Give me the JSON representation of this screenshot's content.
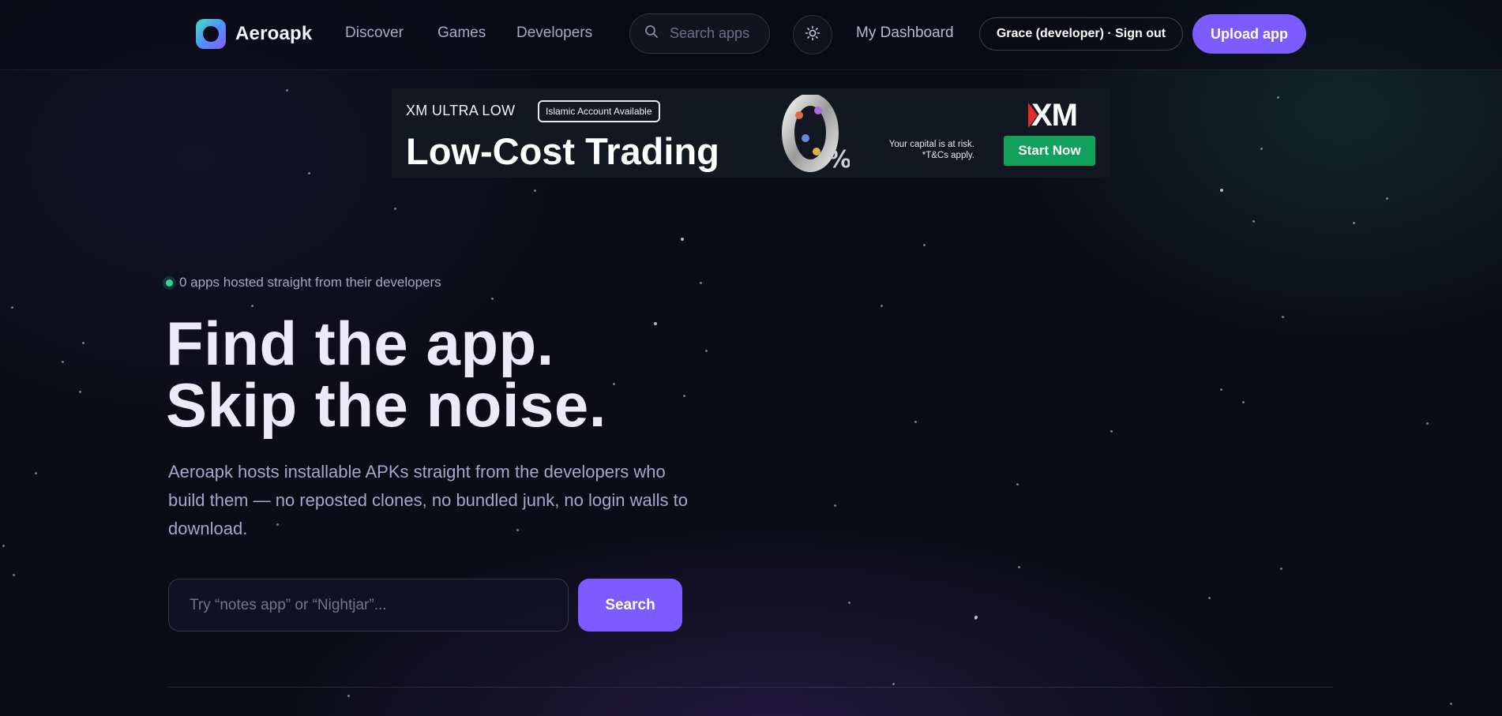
{
  "header": {
    "brand": "Aeroapk",
    "nav": [
      "Discover",
      "Games",
      "Developers"
    ],
    "search_placeholder": "Search apps",
    "dashboard_label": "My Dashboard",
    "account_label": "Grace (developer) · Sign out",
    "upload_label": "Upload app",
    "icons": {
      "search": "search-icon",
      "theme": "sun-icon"
    }
  },
  "ad": {
    "tag": "XM ULTRA LOW",
    "badge": "Islamic Account Available",
    "headline": "Low-Cost Trading",
    "risk_line1": "Your capital is at risk.",
    "risk_line2": "*T&Cs apply.",
    "brand": "XM",
    "cta": "Start Now",
    "colors": {
      "brand_red": "#e22b2b",
      "cta_green": "#12a15a"
    }
  },
  "hero": {
    "status": "0 apps hosted straight from their developers",
    "headline_line1": "Find the app.",
    "headline_line2": "Skip the noise.",
    "subcopy": "Aeroapk hosts installable APKs straight from the developers who build them — no reposted clones, no bundled junk, no login walls to download.",
    "search_placeholder": "Try “notes app” or “Nightjar”...",
    "search_button": "Search"
  },
  "colors": {
    "accent": "#7c5cff",
    "status_green": "#35d49a",
    "background": "#0c0c18"
  }
}
